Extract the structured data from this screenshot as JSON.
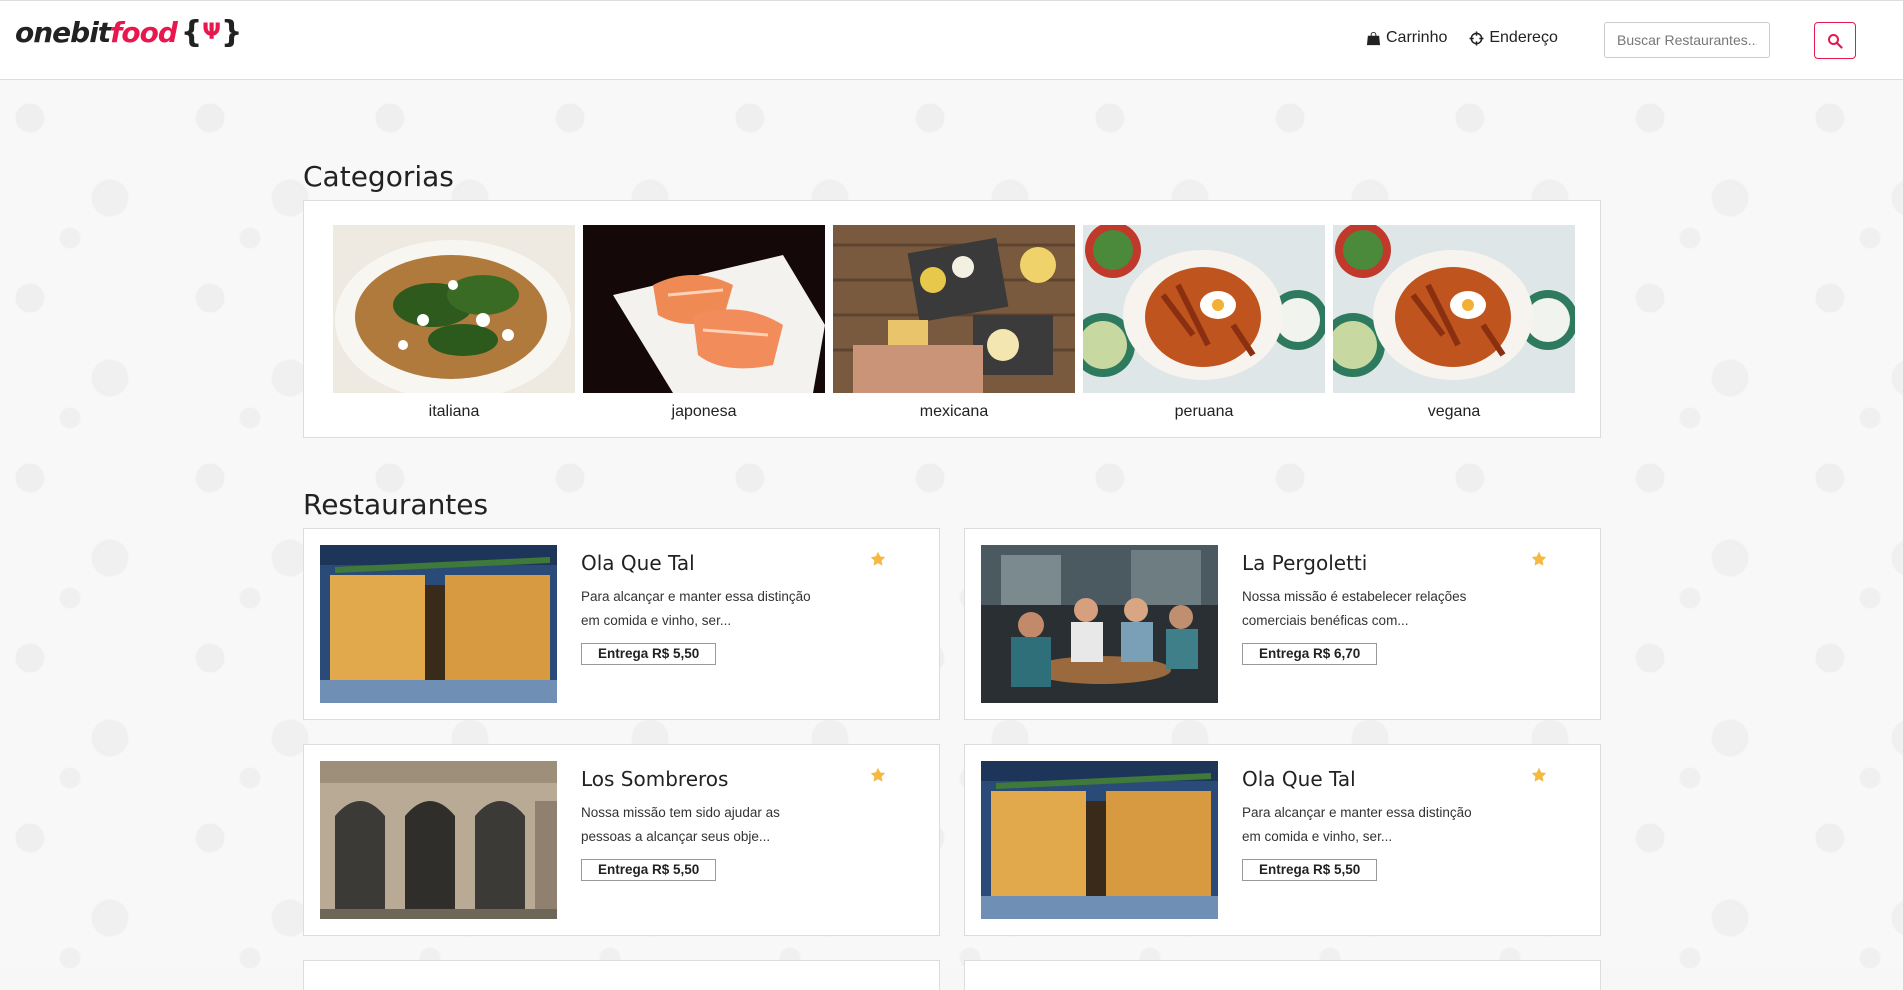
{
  "header": {
    "logo": {
      "part1": "onebit",
      "part2": "food"
    },
    "nav": [
      {
        "label": "Carrinho",
        "icon": "shopping-bag-icon"
      },
      {
        "label": "Endereço",
        "icon": "crosshair-icon"
      }
    ],
    "search": {
      "placeholder": "Buscar Restaurantes...",
      "icon": "search-icon"
    }
  },
  "categories": {
    "title": "Categorias",
    "items": [
      {
        "label": "italiana"
      },
      {
        "label": "japonesa"
      },
      {
        "label": "mexicana"
      },
      {
        "label": "peruana"
      },
      {
        "label": "vegana"
      }
    ]
  },
  "restaurants": {
    "title": "Restaurantes",
    "items": [
      {
        "name": "Ola Que Tal",
        "description": "Para alcançar e manter essa distinção em comida e vinho, ser...",
        "fee": "Entrega R$ 5,50"
      },
      {
        "name": "La Pergoletti",
        "description": "Nossa missão é estabelecer relações comerciais benéficas com...",
        "fee": "Entrega R$ 6,70"
      },
      {
        "name": "Los Sombreros",
        "description": "Nossa missão tem sido ajudar as pessoas a alcançar seus obje...",
        "fee": "Entrega R$ 5,50"
      },
      {
        "name": "Ola Que Tal",
        "description": "Para alcançar e manter essa distinção em comida e vinho, ser...",
        "fee": "Entrega R$ 5,50"
      }
    ]
  },
  "colors": {
    "accent": "#e8174d",
    "star": "#f5b942"
  }
}
